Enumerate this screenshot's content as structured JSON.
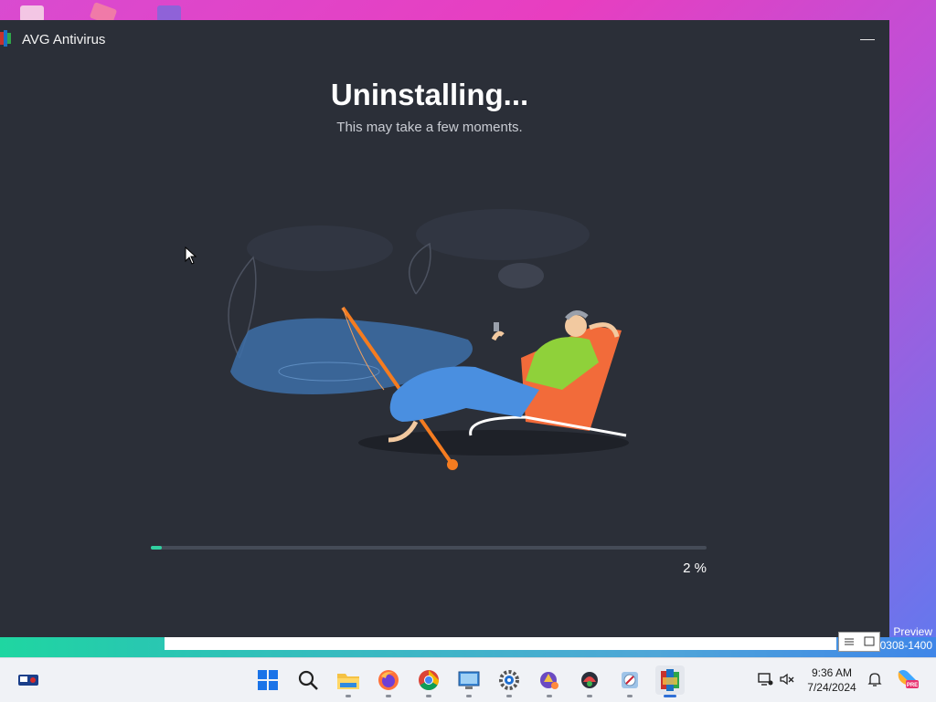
{
  "window": {
    "title": "AVG Antivirus"
  },
  "content": {
    "heading": "Uninstalling...",
    "subheading": "This may take a few moments."
  },
  "progress": {
    "value": 0.02,
    "label": "2 %",
    "color": "#31d0a0"
  },
  "background_window": {
    "preview_line1": "Preview",
    "preview_line2": "0308-1400"
  },
  "taskbar": {
    "apps": [
      "start-icon",
      "search-icon",
      "file-explorer-icon",
      "firefox-icon",
      "chrome-icon",
      "remote-desktop-icon",
      "settings-icon",
      "app-icon-1",
      "app-icon-2",
      "app-icon-3",
      "avg-icon"
    ],
    "time": "9:36 AM",
    "date": "7/24/2024"
  },
  "colors": {
    "window_bg": "#2b2f38",
    "accent": "#31d0a0"
  }
}
